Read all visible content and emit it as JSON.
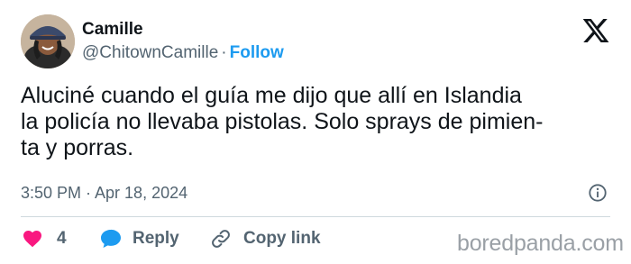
{
  "user": {
    "display_name": "Camille",
    "handle": "@ChitownCamille",
    "separator": "·",
    "follow_label": "Follow"
  },
  "tweet": {
    "lines": [
      "Aluciné cuando el guía me dijo que allí en Islandia",
      "la policía no llevaba pistolas. Solo sprays de pimien-",
      "ta y porras."
    ],
    "timestamp": "3:50 PM · Apr 18, 2024"
  },
  "actions": {
    "like_count": "4",
    "reply_label": "Reply",
    "copy_link_label": "Copy link"
  },
  "watermark": "boredpanda.com",
  "colors": {
    "like": "#f91880",
    "reply": "#1d9bf0",
    "follow": "#1d9bf0",
    "muted": "#536471"
  },
  "icons": {
    "brand": "x-logo-icon",
    "info": "info-icon",
    "like": "heart-icon",
    "reply": "speech-bubble-icon",
    "copy_link": "link-icon"
  }
}
